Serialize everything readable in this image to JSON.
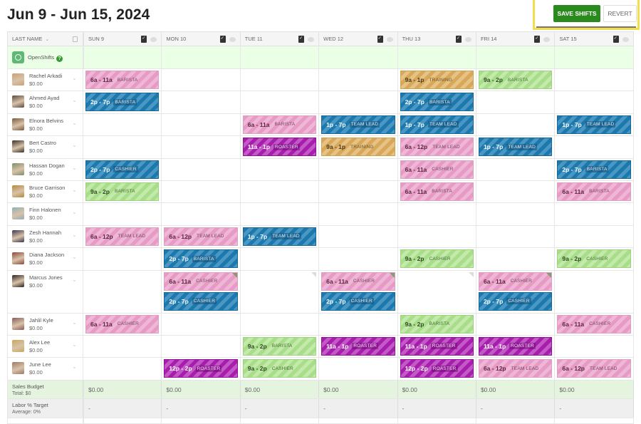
{
  "header": {
    "title": "Jun 9 - Jun 15, 2024",
    "save_label": "SAVE SHIFTS",
    "revert_label": "REVERT"
  },
  "columns": {
    "name_header": "LAST NAME",
    "days": [
      "SUN 9",
      "MON 10",
      "TUE 11",
      "WED 12",
      "THU 13",
      "FRI 14",
      "SAT 15"
    ]
  },
  "open_shifts": {
    "label": "OpenShifts",
    "help_icon": "?"
  },
  "colors": {
    "barista_pink": "#e79ac6",
    "shift_blue": "#1c79ae",
    "training_gold": "#d8a858",
    "shift_green": "#a8dd8a",
    "roaster_purple": "#a91dae",
    "save_green": "#2a8a1e",
    "highlight_yellow": "#f2dd4c"
  },
  "employees": [
    {
      "name": "Rachel Arkadi",
      "wage": "$0.00",
      "avatar_color": "#c9a173",
      "days": [
        [
          {
            "time": "6a - 11a",
            "role": "BARISTA",
            "color": "pink"
          }
        ],
        [],
        [],
        [],
        [
          {
            "time": "9a - 1p",
            "role": "TRAINING",
            "color": "gold"
          }
        ],
        [
          {
            "time": "9a - 2p",
            "role": "BARISTA",
            "color": "green"
          }
        ],
        []
      ]
    },
    {
      "name": "Ahmed Ayad",
      "wage": "$0.00",
      "avatar_color": "#5a4a40",
      "days": [
        [
          {
            "time": "2p - 7p",
            "role": "BARISTA",
            "color": "blue"
          }
        ],
        [],
        [],
        [],
        [
          {
            "time": "2p - 7p",
            "role": "BARISTA",
            "color": "blue"
          }
        ],
        [],
        []
      ]
    },
    {
      "name": "Elnora Belvins",
      "wage": "$0.00",
      "avatar_color": "#7a5a40",
      "days": [
        [],
        [],
        [
          {
            "time": "6a - 11a",
            "role": "BARISTA",
            "color": "pink"
          }
        ],
        [
          {
            "time": "1p - 7p",
            "role": "TEAM LEAD",
            "color": "blue"
          }
        ],
        [
          {
            "time": "1p - 7p",
            "role": "TEAM LEAD",
            "color": "blue"
          }
        ],
        [],
        [
          {
            "time": "1p - 7p",
            "role": "TEAM LEAD",
            "color": "blue"
          }
        ]
      ]
    },
    {
      "name": "Bert Castro",
      "wage": "$0.00",
      "avatar_color": "#3a2e28",
      "days": [
        [],
        [],
        [
          {
            "time": "11a - 1p",
            "role": "ROASTER",
            "color": "purple"
          }
        ],
        [
          {
            "time": "9a - 1p",
            "role": "TRAINING",
            "color": "gold"
          }
        ],
        [
          {
            "time": "6a - 12p",
            "role": "TEAM LEAD",
            "color": "pink"
          }
        ],
        [
          {
            "time": "1p - 7p",
            "role": "TEAM LEAD",
            "color": "blue"
          }
        ],
        []
      ]
    },
    {
      "name": "Hassan Dogan",
      "wage": "$0.00",
      "avatar_color": "#7d8f6a",
      "days": [
        [
          {
            "time": "2p - 7p",
            "role": "CASHIER",
            "color": "blue"
          }
        ],
        [],
        [],
        [],
        [
          {
            "time": "6a - 11a",
            "role": "CASHIER",
            "color": "pink"
          }
        ],
        [],
        [
          {
            "time": "2p - 7p",
            "role": "BARISTA",
            "color": "blue"
          }
        ]
      ]
    },
    {
      "name": "Bruce Garrison",
      "wage": "$0.00",
      "avatar_color": "#b38a3c",
      "days": [
        [
          {
            "time": "9a - 2p",
            "role": "BARISTA",
            "color": "green"
          }
        ],
        [],
        [],
        [],
        [
          {
            "time": "6a - 11a",
            "role": "BARISTA",
            "color": "pink"
          }
        ],
        [],
        [
          {
            "time": "6a - 11a",
            "role": "BARISTA",
            "color": "pink"
          }
        ]
      ]
    },
    {
      "name": "Finn Halonen",
      "wage": "$0.00",
      "avatar_color": "#8fb0b8",
      "days": [
        [],
        [],
        [],
        [],
        [],
        [],
        []
      ]
    },
    {
      "name": "Zesh Hannah",
      "wage": "$0.00",
      "avatar_color": "#3c3550",
      "days": [
        [
          {
            "time": "6a - 12p",
            "role": "TEAM LEAD",
            "color": "pink"
          }
        ],
        [
          {
            "time": "6a - 12p",
            "role": "TEAM LEAD",
            "color": "pink"
          }
        ],
        [
          {
            "time": "1p - 7p",
            "role": "TEAM LEAD",
            "color": "blue"
          }
        ],
        [],
        [],
        [],
        []
      ]
    },
    {
      "name": "Diana Jackson",
      "wage": "$0.00",
      "avatar_color": "#8a4a3a",
      "days": [
        [],
        [
          {
            "time": "2p - 7p",
            "role": "BARISTA",
            "color": "blue"
          }
        ],
        [],
        [],
        [
          {
            "time": "9a - 2p",
            "role": "CASHIER",
            "color": "green"
          }
        ],
        [],
        [
          {
            "time": "9a - 2p",
            "role": "CASHIER",
            "color": "green"
          }
        ]
      ]
    },
    {
      "name": "Marcus Jones",
      "wage": "$0.00",
      "avatar_color": "#2e2320",
      "double": true,
      "days": [
        [],
        [
          {
            "time": "6a - 11a",
            "role": "CASHIER",
            "color": "pink",
            "flag": true
          },
          {
            "time": "2p - 7p",
            "role": "CASHIER",
            "color": "blue"
          }
        ],
        [],
        [
          {
            "time": "6a - 11a",
            "role": "CASHIER",
            "color": "pink",
            "flag": true
          },
          {
            "time": "2p - 7p",
            "role": "CASHIER",
            "color": "blue"
          }
        ],
        [],
        [
          {
            "time": "6a - 11a",
            "role": "CASHIER",
            "color": "pink",
            "flag": true
          },
          {
            "time": "2p - 7p",
            "role": "CASHIER",
            "color": "blue"
          }
        ],
        []
      ],
      "empty_flags": [
        2,
        4
      ]
    },
    {
      "name": "Jahlil Kyle",
      "wage": "$0.00",
      "avatar_color": "#8a5a5a",
      "days": [
        [
          {
            "time": "6a - 11a",
            "role": "CASHIER",
            "color": "pink"
          }
        ],
        [],
        [],
        [],
        [
          {
            "time": "9a - 2p",
            "role": "BARISTA",
            "color": "green"
          }
        ],
        [],
        [
          {
            "time": "6a - 11a",
            "role": "CASHIER",
            "color": "pink"
          }
        ]
      ]
    },
    {
      "name": "Alex Lee",
      "wage": "$0.00",
      "avatar_color": "#c9a85a",
      "days": [
        [],
        [],
        [
          {
            "time": "9a - 2p",
            "role": "BARISTA",
            "color": "green"
          }
        ],
        [
          {
            "time": "11a - 1p",
            "role": "ROASTER",
            "color": "purple"
          }
        ],
        [
          {
            "time": "11a - 1p",
            "role": "ROASTER",
            "color": "purple"
          }
        ],
        [
          {
            "time": "11a - 1p",
            "role": "ROASTER",
            "color": "purple"
          }
        ],
        []
      ]
    },
    {
      "name": "June Lee",
      "wage": "$0.00",
      "avatar_color": "#9a7a68",
      "days": [
        [],
        [
          {
            "time": "12p - 2p",
            "role": "ROASTER",
            "color": "purple"
          }
        ],
        [
          {
            "time": "9a - 2p",
            "role": "CASHIER",
            "color": "green"
          }
        ],
        [],
        [
          {
            "time": "12p - 2p",
            "role": "ROASTER",
            "color": "purple"
          }
        ],
        [
          {
            "time": "6a - 12p",
            "role": "TEAM LEAD",
            "color": "pink"
          }
        ],
        [
          {
            "time": "6a - 12p",
            "role": "TEAM LEAD",
            "color": "pink"
          }
        ]
      ]
    }
  ],
  "summary": {
    "sales": {
      "title": "Sales Budget",
      "subtitle": "Total: $0",
      "values": [
        "$0.00",
        "$0.00",
        "$0.00",
        "$0.00",
        "$0.00",
        "$0.00",
        "$0.00"
      ]
    },
    "labor": {
      "title": "Labor % Target",
      "subtitle": "Average: 0%",
      "values": [
        "-",
        "-",
        "-",
        "-",
        "-",
        "-",
        "-"
      ]
    }
  }
}
